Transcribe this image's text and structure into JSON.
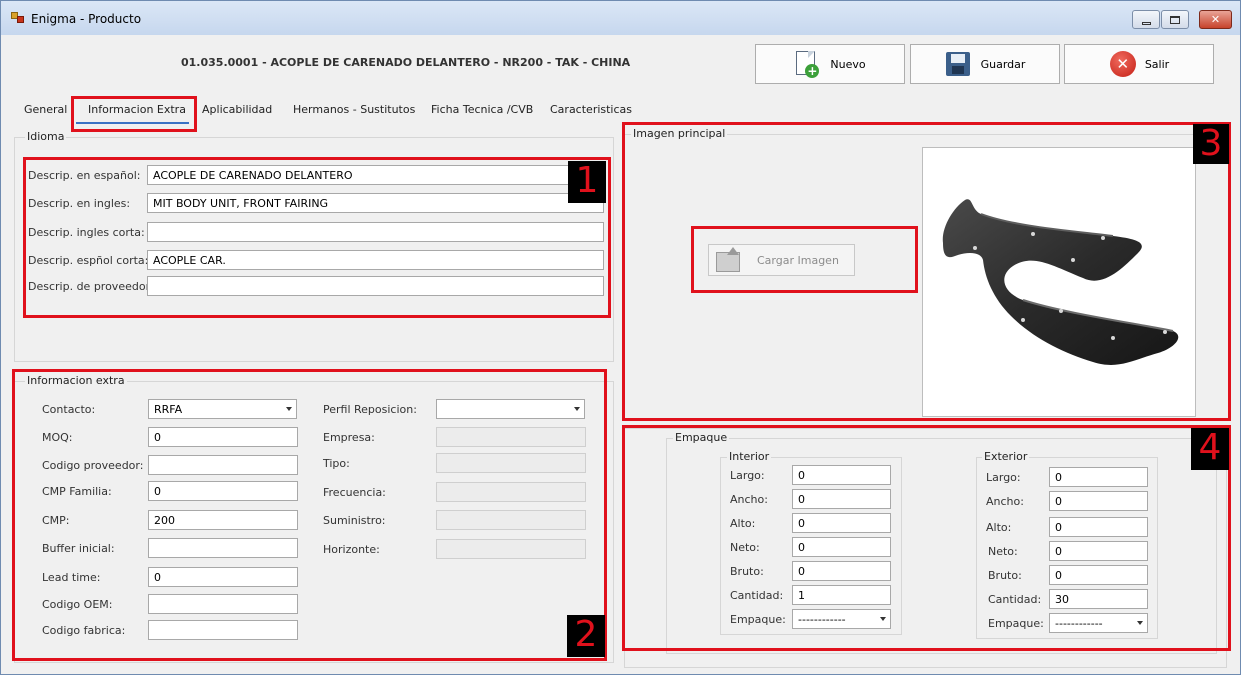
{
  "window": {
    "title": "Enigma - Producto",
    "min_glyph": "",
    "max_glyph": "",
    "close_glyph": "✕"
  },
  "product_title": "01.035.0001 - ACOPLE DE CARENADO DELANTERO - NR200 - TAK - CHINA",
  "toolbar": {
    "nuevo": "Nuevo",
    "guardar": "Guardar",
    "salir": "Salir",
    "plus_glyph": "+",
    "x_glyph": "✕"
  },
  "tabs": [
    {
      "label": "General"
    },
    {
      "label": "Informacion Extra"
    },
    {
      "label": "Aplicabilidad"
    },
    {
      "label": "Hermanos - Sustitutos"
    },
    {
      "label": "Ficha Tecnica /CVB"
    },
    {
      "label": "Caracteristicas"
    }
  ],
  "idioma": {
    "label": "Idioma",
    "fields": [
      {
        "label": "Descrip. en español:",
        "value": "ACOPLE DE CARENADO DELANTERO"
      },
      {
        "label": "Descrip. en ingles:",
        "value": "MIT BODY UNIT, FRONT FAIRING"
      },
      {
        "label": "Descrip. ingles corta:",
        "value": ""
      },
      {
        "label": "Descrip. espñol corta:",
        "value": "ACOPLE CAR."
      },
      {
        "label": "Descrip. de proveedor:",
        "value": ""
      }
    ]
  },
  "info_extra": {
    "label": "Informacion extra",
    "left": [
      {
        "label": "Contacto:",
        "value": "RRFA"
      },
      {
        "label": "MOQ:",
        "value": "0"
      },
      {
        "label": "Codigo proveedor:",
        "value": ""
      },
      {
        "label": "CMP Familia:",
        "value": "0"
      },
      {
        "label": "CMP:",
        "value": "200"
      },
      {
        "label": "Buffer inicial:",
        "value": ""
      },
      {
        "label": "Lead time:",
        "value": "0"
      },
      {
        "label": "Codigo OEM:",
        "value": ""
      },
      {
        "label": "Codigo fabrica:",
        "value": ""
      }
    ],
    "right": [
      {
        "label": "Perfil Reposicion:",
        "value": ""
      },
      {
        "label": "Empresa:",
        "value": ""
      },
      {
        "label": "Tipo:",
        "value": ""
      },
      {
        "label": "Frecuencia:",
        "value": ""
      },
      {
        "label": "Suministro:",
        "value": ""
      },
      {
        "label": "Horizonte:",
        "value": ""
      }
    ]
  },
  "imagen": {
    "label": "Imagen principal",
    "load_button": "Cargar Imagen"
  },
  "empaque": {
    "label": "Empaque",
    "interior": {
      "label": "Interior",
      "fields": [
        {
          "label": "Largo:",
          "value": "0"
        },
        {
          "label": "Ancho:",
          "value": "0"
        },
        {
          "label": "Alto:",
          "value": "0"
        },
        {
          "label": "Neto:",
          "value": "0"
        },
        {
          "label": "Bruto:",
          "value": "0"
        },
        {
          "label": "Cantidad:",
          "value": "1"
        },
        {
          "label": "Empaque:",
          "value": "------------"
        }
      ]
    },
    "exterior": {
      "label": "Exterior",
      "fields": [
        {
          "label": "Largo:",
          "value": "0"
        },
        {
          "label": "Ancho:",
          "value": "0"
        },
        {
          "label": "Alto:",
          "value": "0"
        },
        {
          "label": "Neto:",
          "value": "0"
        },
        {
          "label": "Bruto:",
          "value": "0"
        },
        {
          "label": "Cantidad:",
          "value": "30"
        },
        {
          "label": "Empaque:",
          "value": "------------"
        }
      ]
    }
  },
  "annotations": {
    "marker_1": "1",
    "marker_2": "2",
    "marker_3": "3",
    "marker_4": "4",
    "color": "#e0111c"
  },
  "colors": {
    "accent_tab": "#3a72c4",
    "annotation_red": "#e0111c",
    "window_bg": "#f0f0f0"
  }
}
